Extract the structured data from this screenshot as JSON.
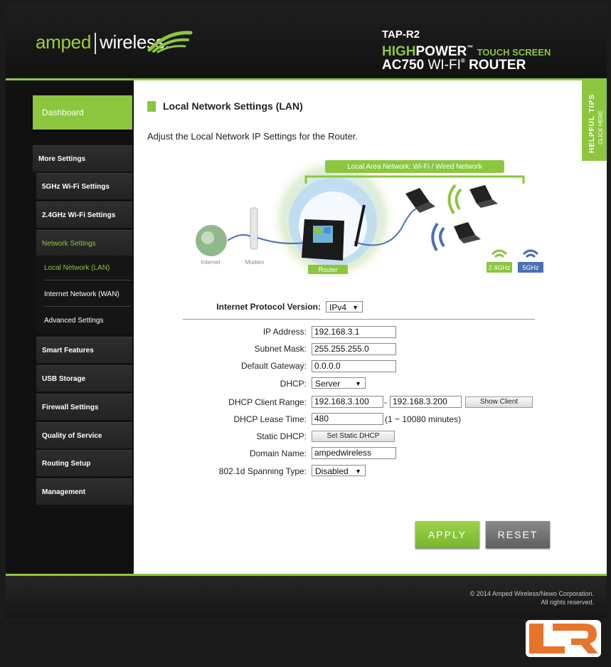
{
  "header": {
    "logo_left": "amped",
    "logo_right": "wireless.",
    "model": "TAP-R2",
    "line1_high": "HIGH",
    "line1_power": "POWER",
    "line1_tm": "™",
    "line1_touch": "TOUCH SCREEN",
    "line2_ac": "AC750",
    "line2_wifi": "WI-FI",
    "line2_reg": "®",
    "line2_router": "ROUTER"
  },
  "sidebar": {
    "dashboard": "Dashboard",
    "more_settings": "More Settings",
    "items": [
      {
        "label": "5GHz Wi-Fi Settings"
      },
      {
        "label": "2.4GHz Wi-Fi Settings"
      },
      {
        "label": "Network Settings"
      }
    ],
    "sub_items": [
      {
        "label": "Local Network (LAN)"
      },
      {
        "label": "Internet Network (WAN)"
      },
      {
        "label": "Advanced Settings"
      }
    ],
    "bottom_items": [
      {
        "label": "Smart Features"
      },
      {
        "label": "USB Storage"
      },
      {
        "label": "Firewall Settings"
      },
      {
        "label": "Quality of Service"
      },
      {
        "label": "Routing Setup"
      },
      {
        "label": "Management"
      }
    ]
  },
  "tips": {
    "title": "HELPFUL TIPS",
    "sub": "CLICK HERE"
  },
  "main": {
    "title": "Local Network Settings (LAN)",
    "subtitle": "Adjust the Local Network IP Settings for the Router."
  },
  "diagram": {
    "banner": "Local Area Network: Wi-Fi / Wired Network",
    "internet": "Internet",
    "modem": "Modem",
    "router": "Router",
    "band_24": "2.4GHz",
    "band_5": "5GHz"
  },
  "form": {
    "ip_version_label": "Internet Protocol Version:",
    "ip_version_value": "IPv4",
    "ip_address_label": "IP Address:",
    "ip_address_value": "192.168.3.1",
    "subnet_label": "Subnet Mask:",
    "subnet_value": "255.255.255.0",
    "gateway_label": "Default Gateway:",
    "gateway_value": "0.0.0.0",
    "dhcp_label": "DHCP:",
    "dhcp_value": "Server",
    "range_label": "DHCP Client Range:",
    "range_start": "192.168.3.100",
    "range_dash": "-",
    "range_end": "192.168.3.200",
    "show_client": "Show Client",
    "lease_label": "DHCP Lease Time:",
    "lease_value": "480",
    "lease_hint": "(1 ~ 10080 minutes)",
    "static_label": "Static DHCP:",
    "static_button": "Set Static DHCP",
    "domain_label": "Domain Name:",
    "domain_value": "ampedwireless",
    "spanning_label": "802.1d Spanning Type:",
    "spanning_value": "Disabled"
  },
  "actions": {
    "apply": "APPLY",
    "reset": "RESET"
  },
  "footer": {
    "copyright": "© 2014 Amped Wireless/Newo Corporation.",
    "rights": "All rights reserved."
  },
  "colors": {
    "accent": "#8cc63f",
    "dark": "#1b1b1b"
  }
}
